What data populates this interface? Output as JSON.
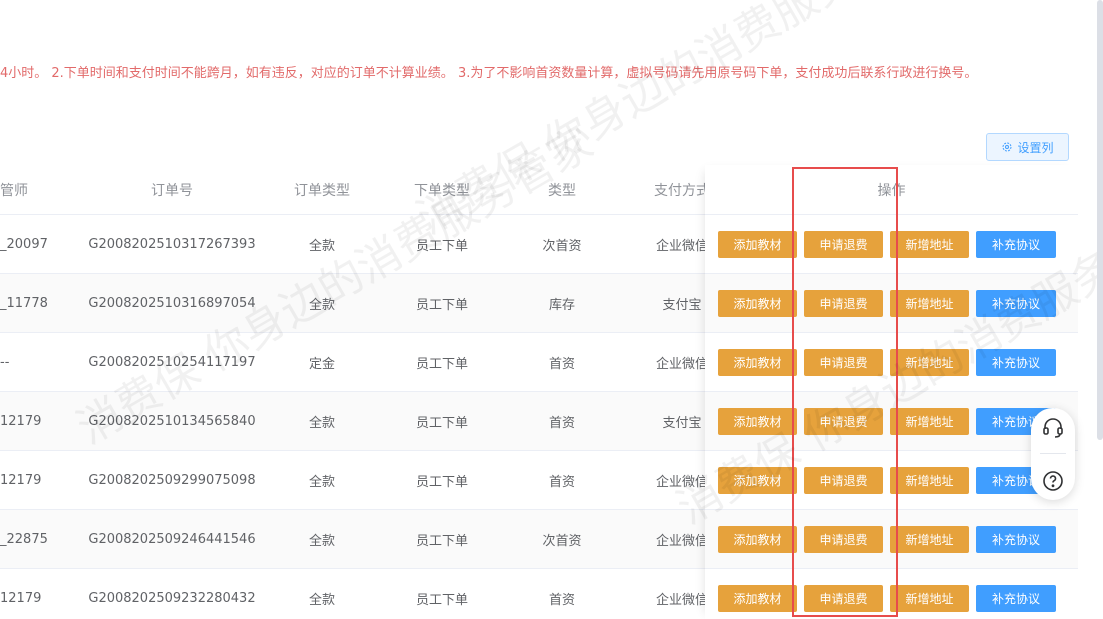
{
  "notice": "4小时。 2.下单时间和支付时间不能跨月，如有违反，对应的订单不计算业绩。 3.为了不影响首资数量计算，虚拟号码请先用原号码下单，支付成功后联系行政进行换号。",
  "set_columns_label": "设置列",
  "watermark_text": "消费保 你身边的消费服务管家",
  "columns": {
    "advisor": "管师",
    "order_no": "订单号",
    "order_type": "订单类型",
    "place_type": "下单类型",
    "type": "类型",
    "pay_method": "支付方式",
    "actions": "操作"
  },
  "actions": {
    "add_material": "添加教材",
    "apply_refund": "申请退费",
    "add_address": "新增地址",
    "supplement_agreement": "补充协议"
  },
  "rows": [
    {
      "advisor": "_20097",
      "order_no": "G2008202510317267393",
      "order_type": "全款",
      "place_type": "员工下单",
      "type": "次首资",
      "pay_method": "企业微信"
    },
    {
      "advisor": "_11778",
      "order_no": "G2008202510316897054",
      "order_type": "全款",
      "place_type": "员工下单",
      "type": "库存",
      "pay_method": "支付宝"
    },
    {
      "advisor": "--",
      "order_no": "G2008202510254117197",
      "order_type": "定金",
      "place_type": "员工下单",
      "type": "首资",
      "pay_method": "企业微信"
    },
    {
      "advisor": "12179",
      "order_no": "G2008202510134565840",
      "order_type": "全款",
      "place_type": "员工下单",
      "type": "首资",
      "pay_method": "支付宝"
    },
    {
      "advisor": "12179",
      "order_no": "G2008202509299075098",
      "order_type": "全款",
      "place_type": "员工下单",
      "type": "首资",
      "pay_method": "企业微信"
    },
    {
      "advisor": "_22875",
      "order_no": "G2008202509246441546",
      "order_type": "全款",
      "place_type": "员工下单",
      "type": "次首资",
      "pay_method": "企业微信"
    },
    {
      "advisor": "12179",
      "order_no": "G2008202509232280432",
      "order_type": "全款",
      "place_type": "员工下单",
      "type": "首资",
      "pay_method": "企业微信"
    }
  ],
  "colors": {
    "warning": "#e6a23c",
    "primary": "#409eff",
    "notice": "#e26a6a",
    "highlight": "#e74c4c"
  },
  "icons": {
    "set_columns": "gear-icon",
    "support": "headset-icon",
    "help": "question-icon"
  }
}
